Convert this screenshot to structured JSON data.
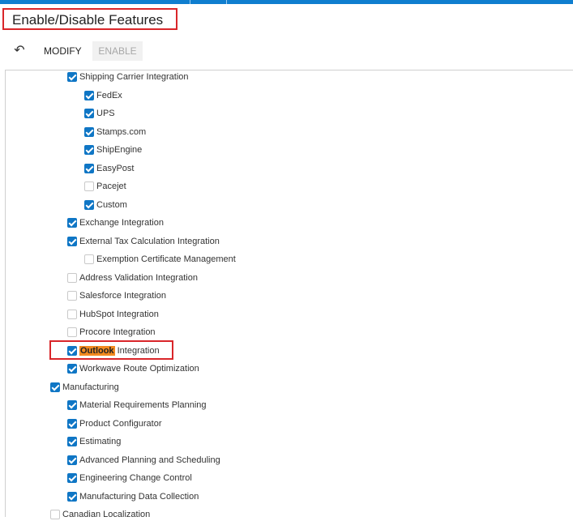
{
  "header": {
    "title": "Enable/Disable Features"
  },
  "toolbar": {
    "modify_label": "MODIFY",
    "enable_label": "ENABLE",
    "undo_icon": "undo-icon"
  },
  "colors": {
    "accent": "#0f7ecf",
    "highlight_box": "#d9262a",
    "search_highlight": "#f28a1f"
  },
  "features": {
    "shipping_carrier": {
      "label": "Shipping Carrier Integration",
      "checked": true
    },
    "fedex": {
      "label": "FedEx",
      "checked": true
    },
    "ups": {
      "label": "UPS",
      "checked": true
    },
    "stamps": {
      "label": "Stamps.com",
      "checked": true
    },
    "shipengine": {
      "label": "ShipEngine",
      "checked": true
    },
    "easypost": {
      "label": "EasyPost",
      "checked": true
    },
    "pacejet": {
      "label": "Pacejet",
      "checked": false
    },
    "custom": {
      "label": "Custom",
      "checked": true
    },
    "exchange": {
      "label": "Exchange Integration",
      "checked": true
    },
    "external_tax": {
      "label": "External Tax Calculation Integration",
      "checked": true
    },
    "exemption_cert": {
      "label": "Exemption Certificate Management",
      "checked": false
    },
    "address_validation": {
      "label": "Address Validation Integration",
      "checked": false
    },
    "salesforce": {
      "label": "Salesforce Integration",
      "checked": false
    },
    "hubspot": {
      "label": "HubSpot Integration",
      "checked": false
    },
    "procore": {
      "label": "Procore Integration",
      "checked": false
    },
    "outlook": {
      "highlight": "Outlook",
      "label_rest": " Integration",
      "checked": true
    },
    "workwave": {
      "label": "Workwave Route Optimization",
      "checked": true
    },
    "manufacturing": {
      "label": "Manufacturing",
      "checked": true
    },
    "mrp": {
      "label": "Material Requirements Planning",
      "checked": true
    },
    "product_config": {
      "label": "Product Configurator",
      "checked": true
    },
    "estimating": {
      "label": "Estimating",
      "checked": true
    },
    "aps": {
      "label": "Advanced Planning and Scheduling",
      "checked": true
    },
    "eco": {
      "label": "Engineering Change Control",
      "checked": true
    },
    "mdc": {
      "label": "Manufacturing Data Collection",
      "checked": true
    },
    "canadian": {
      "label": "Canadian Localization",
      "checked": false
    }
  }
}
